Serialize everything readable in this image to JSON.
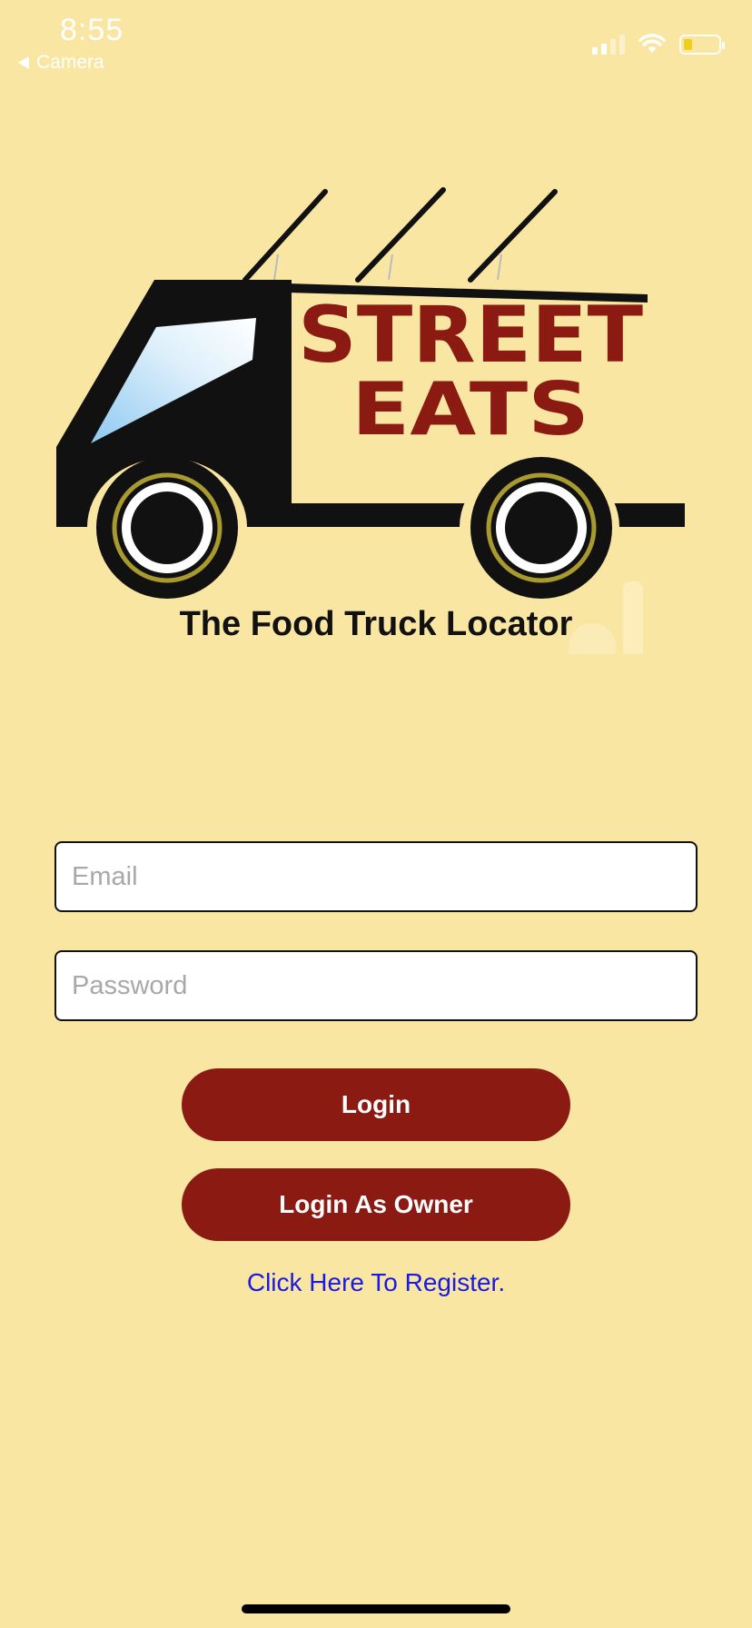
{
  "status_bar": {
    "time": "8:55",
    "back_label": "Camera",
    "battery_level": 0.25
  },
  "logo": {
    "line1": "STREET",
    "line2": "EATS",
    "tagline": "The Food Truck Locator"
  },
  "form": {
    "email_placeholder": "Email",
    "password_placeholder": "Password"
  },
  "buttons": {
    "login": "Login",
    "login_owner": "Login As Owner"
  },
  "register_link": "Click Here To Register.",
  "colors": {
    "background": "#FAE6A3",
    "brand": "#8A1A12",
    "link": "#1A1AE6"
  },
  "icons": [
    "signal-icon",
    "wifi-icon",
    "battery-icon",
    "back-arrow-icon",
    "food-truck-logo"
  ]
}
